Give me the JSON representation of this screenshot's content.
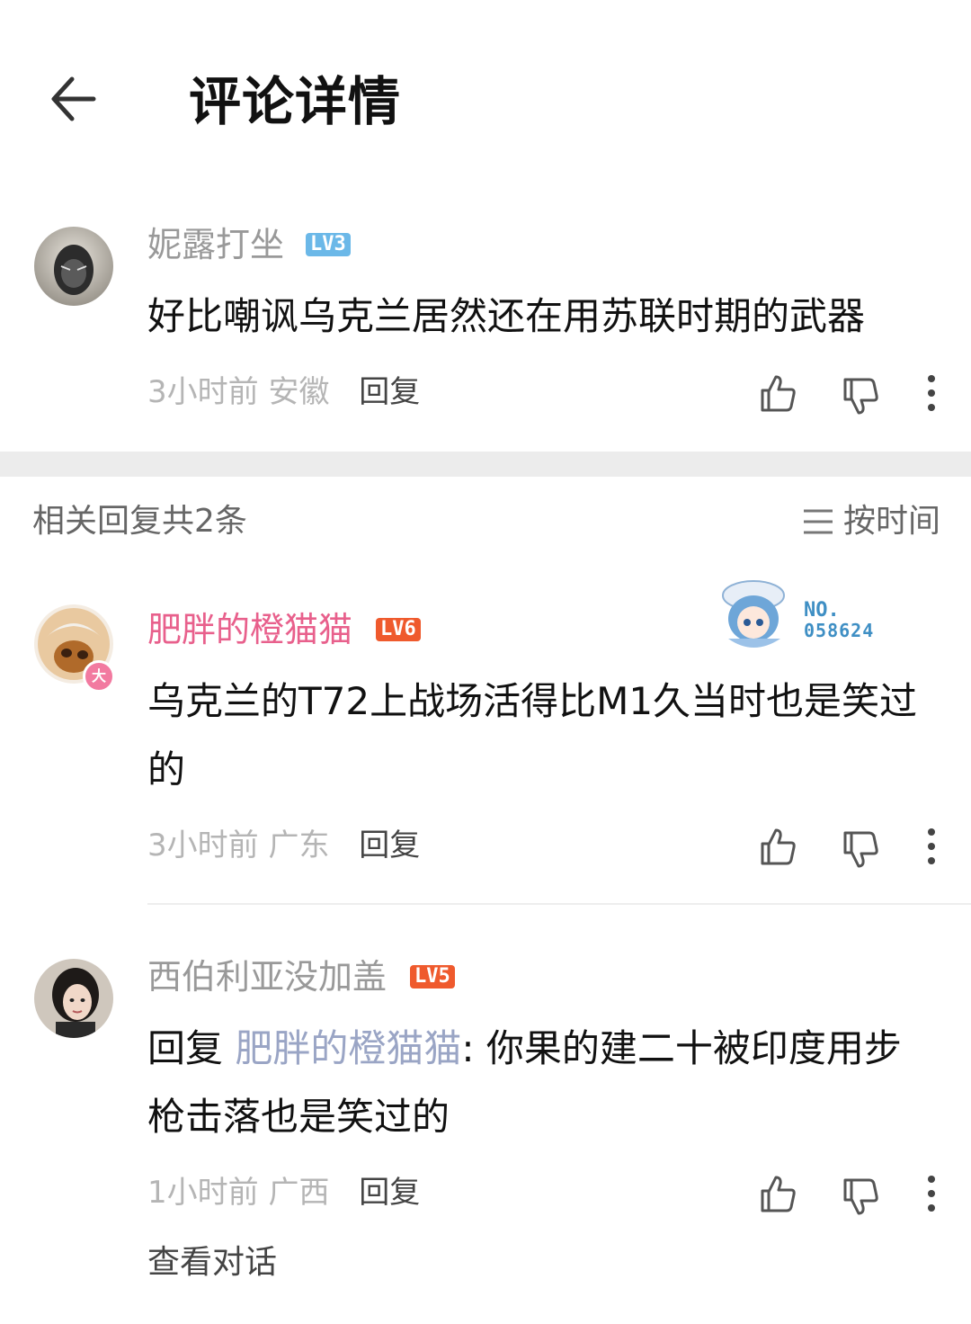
{
  "header": {
    "title": "评论详情"
  },
  "main_comment": {
    "username": "妮露打坐",
    "level": "LV3",
    "content": "好比嘲讽乌克兰居然还在用苏联时期的武器",
    "time": "3小时前",
    "location": "安徽",
    "reply_label": "回复"
  },
  "replies_header": {
    "count_text": "相关回复共2条",
    "sort_label": "按时间"
  },
  "replies": [
    {
      "username": "肥胖的橙猫猫",
      "level": "LV6",
      "avatar_badge": "大",
      "fan_badge_no": "NO.",
      "fan_badge_number": "058624",
      "content": "乌克兰的T72上战场活得比M1久当时也是笑过的",
      "time": "3小时前",
      "location": "广东",
      "reply_label": "回复"
    },
    {
      "username": "西伯利亚没加盖",
      "level": "LV5",
      "content_prefix": "回复 ",
      "mention": "肥胖的橙猫猫",
      "content": ": 你果的建二十被印度用步枪击落也是笑过的",
      "time": "1小时前",
      "location": "广西",
      "reply_label": "回复",
      "view_conversation": "查看对话"
    }
  ],
  "colors": {
    "lv3": "#6bb8e8",
    "lv5_lv6": "#ef5a2d",
    "vip_name": "#e8608c",
    "muted": "#b5b5b5"
  }
}
